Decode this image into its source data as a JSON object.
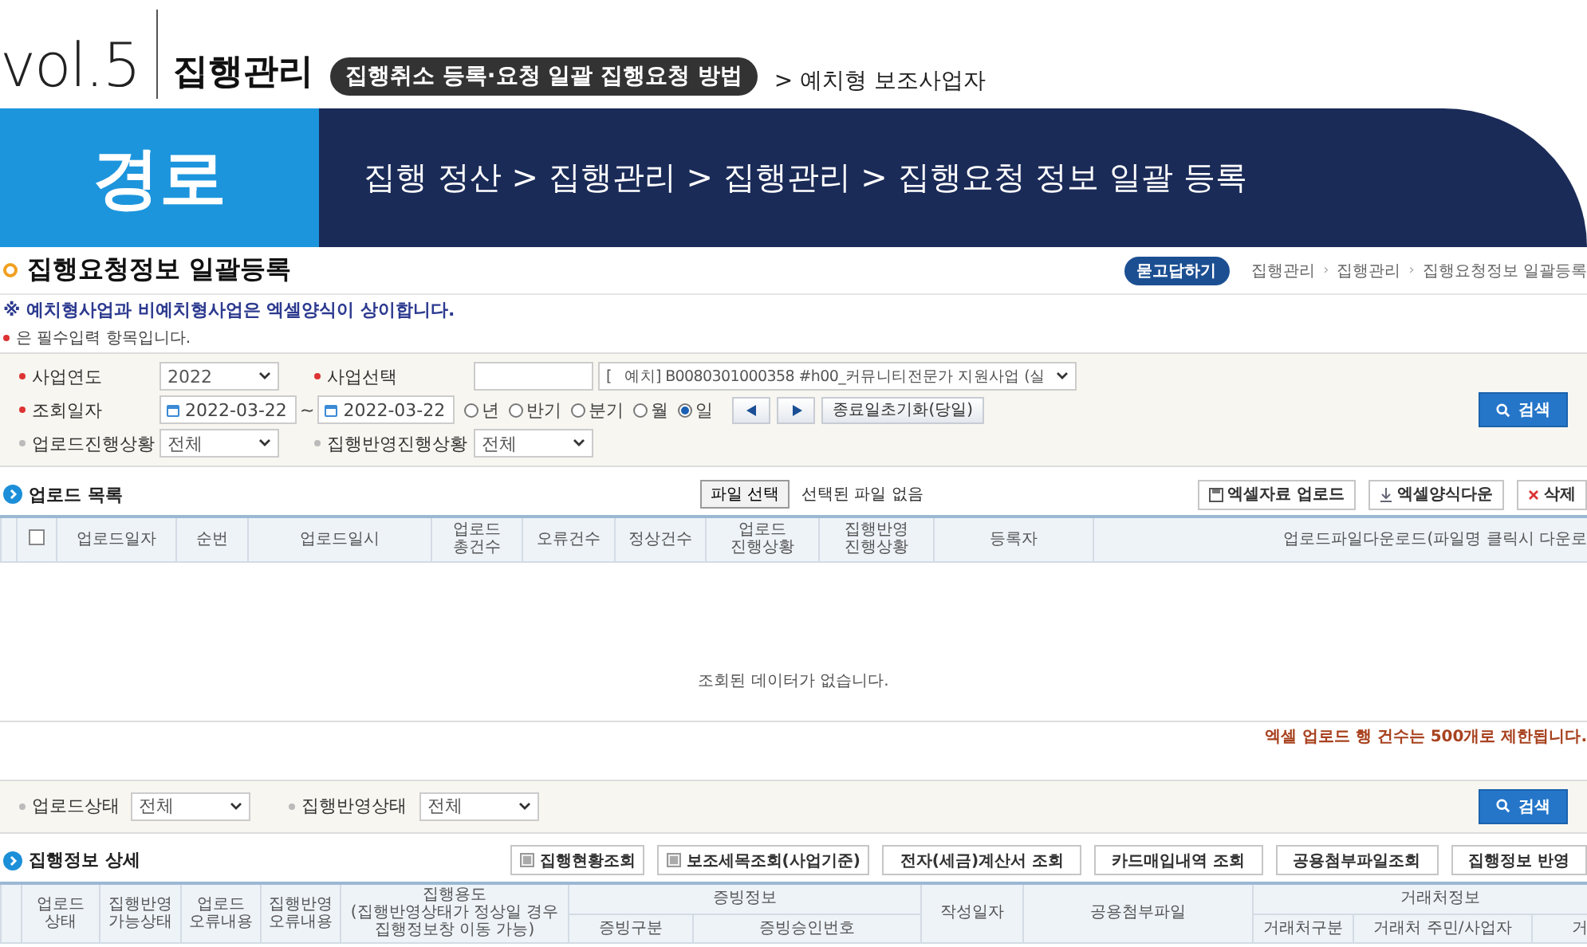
{
  "header": {
    "volume": "vol.5",
    "section": "집행관리",
    "topic": "집행취소 등록·요청 일괄 집행요청 방법",
    "subtopic": "> 예치형 보조사업자"
  },
  "banner": {
    "label": "경로",
    "path": "집행 정산 > 집행관리 > 집행관리 > 집행요청 정보 일괄 등록"
  },
  "page": {
    "title": "집행요청정보 일괄등록",
    "help_button": "묻고답하기",
    "breadcrumb": [
      "집행관리",
      "집행관리",
      "집행요청정보 일괄등록"
    ],
    "breadcrumb_separator": "›"
  },
  "notes": [
    {
      "kind": "warning",
      "text": "※ 예치형사업과 비예치형사업은 엑셀양식이 상이합니다."
    },
    {
      "kind": "required",
      "text": "은 필수입력 항목입니다."
    }
  ],
  "search": {
    "rows": [
      [
        {
          "kind": "select",
          "label": "사업연도",
          "required": true,
          "value": "2022"
        },
        {
          "kind": "business",
          "label": "사업선택",
          "required": true,
          "value": "[   예치] B0080301000358 #h00_커뮤니티전문가 지원사업 (실"
        }
      ],
      [
        {
          "kind": "daterange",
          "label": "조회일자",
          "required": true,
          "from": "2022-03-22",
          "separator": "~",
          "to": "2022-03-22",
          "periods": [
            {
              "label": "년",
              "selected": false
            },
            {
              "label": "반기",
              "selected": false
            },
            {
              "label": "분기",
              "selected": false
            },
            {
              "label": "월",
              "selected": false
            },
            {
              "label": "일",
              "selected": true
            }
          ],
          "reset_button": "종료일초기화(당일)"
        }
      ],
      [
        {
          "kind": "select",
          "label": "업로드진행상황",
          "required": false,
          "value": "전체"
        },
        {
          "kind": "select",
          "label": "집행반영진행상황",
          "required": false,
          "value": "전체"
        }
      ]
    ],
    "button": "검색"
  },
  "upload": {
    "title": "업로드 목록",
    "file_button": "파일 선택",
    "file_status": "선택된 파일 없음",
    "buttons": [
      {
        "kind": "save",
        "label": "엑셀자료 업로드"
      },
      {
        "kind": "download",
        "label": "엑셀양식다운"
      },
      {
        "kind": "delete",
        "label": "삭제"
      }
    ],
    "header_checked": false,
    "columns": [
      "업로드일자",
      "순번",
      "업로드일시",
      "업로드\n총건수",
      "오류건수",
      "정상건수",
      "업로드\n진행상황",
      "집행반영\n진행상황",
      "등록자",
      "업로드파일다운로드(파일명 클릭시 다운로"
    ],
    "empty_message": "조회된 데이터가 없습니다.",
    "limit_note": "엑셀 업로드 행 건수는 500개로 제한됩니다."
  },
  "filter": {
    "fields": [
      {
        "label": "업로드상태",
        "required": false,
        "value": "전체"
      },
      {
        "label": "집행반영상태",
        "required": false,
        "value": "전체"
      }
    ],
    "button": "검색"
  },
  "detail": {
    "title": "집행정보 상세",
    "buttons": [
      {
        "kind": "icon",
        "label": "집행현황조회"
      },
      {
        "kind": "icon",
        "label": "보조세목조회(사업기준)"
      },
      {
        "kind": "plain",
        "label": "전자(세금)계산서 조회"
      },
      {
        "kind": "plain",
        "label": "카드매입내역 조회"
      },
      {
        "kind": "plain",
        "label": "공용첨부파일조회"
      },
      {
        "kind": "plain",
        "label": "집행정보 반영"
      }
    ],
    "columns": [
      {
        "label": "업로드\n상태"
      },
      {
        "label": "집행반영\n가능상태"
      },
      {
        "label": "업로드\n오류내용"
      },
      {
        "label": "집행반영\n오류내용"
      },
      {
        "label": "집행용도\n(집행반영상태가 정상일 경우\n집행정보창 이동 가능)"
      },
      {
        "label": "증빙정보",
        "children": [
          "증빙구분",
          "증빙승인번호"
        ]
      },
      {
        "label": "작성일자"
      },
      {
        "label": "공용첨부파일"
      },
      {
        "label": "거래처정보",
        "children": [
          "거래처구분",
          "거래처 주민/사업자",
          "거"
        ]
      }
    ]
  }
}
